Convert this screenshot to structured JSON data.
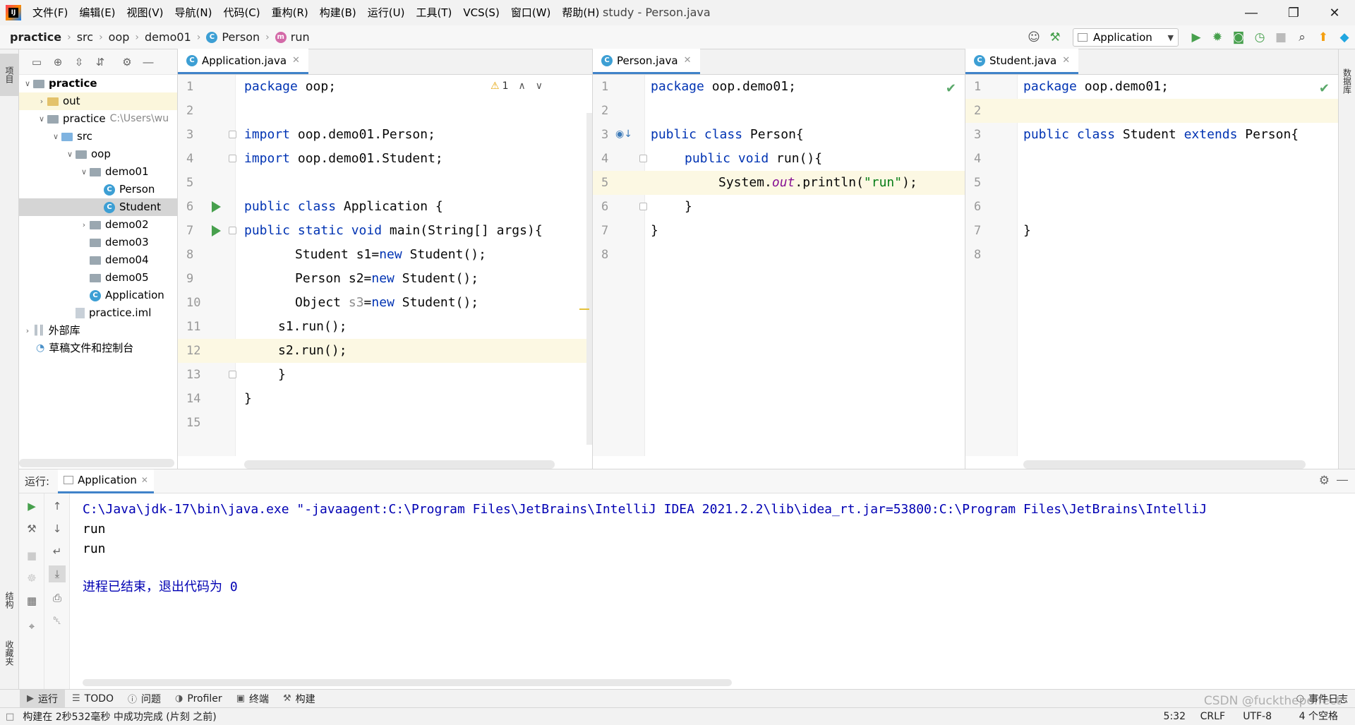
{
  "menu": {
    "items": [
      "文件(F)",
      "编辑(E)",
      "视图(V)",
      "导航(N)",
      "代码(C)",
      "重构(R)",
      "构建(B)",
      "运行(U)",
      "工具(T)",
      "VCS(S)",
      "窗口(W)",
      "帮助(H)"
    ],
    "window_title": "study - Person.java"
  },
  "breadcrumb": {
    "items": [
      "practice",
      "src",
      "oop",
      "demo01",
      "Person",
      "run"
    ]
  },
  "toolbar": {
    "run_config": "Application"
  },
  "side_tabs": {
    "project": "项目",
    "structure": "结构",
    "favorites": "收藏夹",
    "database": "数据库"
  },
  "project_tree": {
    "rows": [
      {
        "label": "practice"
      },
      {
        "label": "out"
      },
      {
        "label": "practice",
        "sub": "C:\\Users\\wu"
      },
      {
        "label": "src"
      },
      {
        "label": "oop"
      },
      {
        "label": "demo01"
      },
      {
        "label": "Person"
      },
      {
        "label": "Student"
      },
      {
        "label": "demo02"
      },
      {
        "label": "demo03"
      },
      {
        "label": "demo04"
      },
      {
        "label": "demo05"
      },
      {
        "label": "Application"
      },
      {
        "label": "practice.iml"
      },
      {
        "label": "外部库"
      },
      {
        "label": "草稿文件和控制台"
      }
    ]
  },
  "editors": [
    {
      "tab": "Application.java",
      "warning_count": "1",
      "line_numbers": [
        "1",
        "2",
        "3",
        "4",
        "5",
        "6",
        "7",
        "8",
        "9",
        "10",
        "11",
        "12",
        "13",
        "14",
        "15"
      ]
    },
    {
      "tab": "Person.java",
      "line_numbers": [
        "1",
        "2",
        "3",
        "4",
        "5",
        "6",
        "7",
        "8"
      ]
    },
    {
      "tab": "Student.java",
      "line_numbers": [
        "1",
        "2",
        "3",
        "4",
        "5",
        "6",
        "7",
        "8"
      ]
    }
  ],
  "run_panel": {
    "label": "运行:",
    "tab": "Application",
    "command": "C:\\Java\\jdk-17\\bin\\java.exe \"-javaagent:C:\\Program Files\\JetBrains\\IntelliJ IDEA 2021.2.2\\lib\\idea_rt.jar=53800:C:\\Program Files\\JetBrains\\IntelliJ",
    "output": [
      "run",
      "run"
    ],
    "exit_message": "进程已结束，退出代码为 0"
  },
  "bottom_bar": {
    "items": [
      "运行",
      "TODO",
      "问题",
      "Profiler",
      "终端",
      "构建"
    ],
    "event_log": "事件日志"
  },
  "status_bar": {
    "message": "构建在 2秒532毫秒 中成功完成 (片刻 之前)",
    "position": "5:32",
    "line_sep": "CRLF",
    "encoding": "UTF-8",
    "indent": "4 个空格",
    "watermark": "CSDN @fuckthepeffect"
  }
}
